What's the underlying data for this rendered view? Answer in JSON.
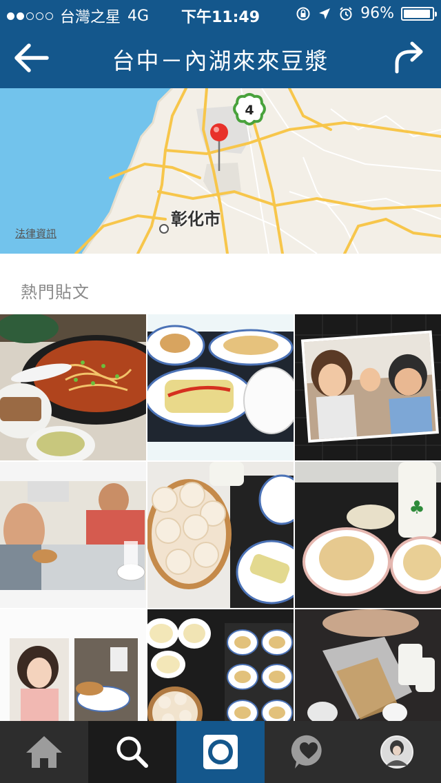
{
  "status_bar": {
    "carrier": "台灣之星",
    "network": "4G",
    "time": "下午11:49",
    "battery": "96%",
    "battery_level": 0.96
  },
  "nav": {
    "title": "台中－內湖來來豆漿",
    "back_icon": "back-arrow-icon",
    "share_icon": "share-arrow-icon"
  },
  "map": {
    "city_label": "彰化市",
    "legal_label": "法律資訊",
    "cluster_count": "4"
  },
  "section": {
    "title": "熱門貼文"
  },
  "posts": [
    {
      "subject": "beef noodle soup"
    },
    {
      "subject": "scallion pancakes and soy milk"
    },
    {
      "subject": "friends selfie"
    },
    {
      "subject": "people dining"
    },
    {
      "subject": "steamed dumplings"
    },
    {
      "subject": "pastries and drink"
    },
    {
      "subject": "selfie collage"
    },
    {
      "subject": "breakfast spread"
    },
    {
      "subject": "takeout bags"
    }
  ],
  "tabs": [
    {
      "icon": "home-icon"
    },
    {
      "icon": "search-icon"
    },
    {
      "icon": "camera-icon"
    },
    {
      "icon": "activity-heart-icon"
    },
    {
      "icon": "profile-avatar-icon"
    }
  ],
  "colors": {
    "brand": "#14578c",
    "tabbar": "#2d2d2d",
    "pin": "#e8312a"
  }
}
